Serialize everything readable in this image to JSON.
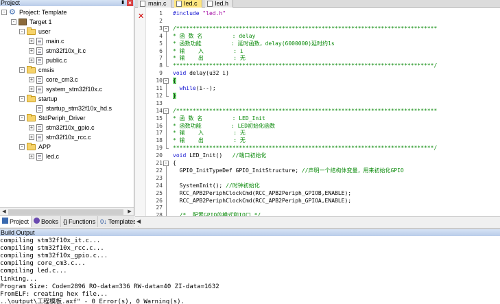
{
  "project_panel": {
    "title": "Project",
    "pin_icon": "pin-icon",
    "close_icon": "close-icon",
    "tree": [
      {
        "label": "Project: Template",
        "level": 0,
        "kind": "project",
        "expander": "-"
      },
      {
        "label": "Target 1",
        "level": 1,
        "kind": "target",
        "expander": "-"
      },
      {
        "label": "user",
        "level": 2,
        "kind": "folder",
        "expander": "-"
      },
      {
        "label": "main.c",
        "level": 3,
        "kind": "file",
        "expander": "+"
      },
      {
        "label": "stm32f10x_it.c",
        "level": 3,
        "kind": "file",
        "expander": "+"
      },
      {
        "label": "public.c",
        "level": 3,
        "kind": "file",
        "expander": "+"
      },
      {
        "label": "cmsis",
        "level": 2,
        "kind": "folder",
        "expander": "-"
      },
      {
        "label": "core_cm3.c",
        "level": 3,
        "kind": "file",
        "expander": "+"
      },
      {
        "label": "system_stm32f10x.c",
        "level": 3,
        "kind": "file",
        "expander": "+"
      },
      {
        "label": "startup",
        "level": 2,
        "kind": "folder",
        "expander": "-"
      },
      {
        "label": "startup_stm32f10x_hd.s",
        "level": 3,
        "kind": "file",
        "expander": ""
      },
      {
        "label": "StdPeriph_Driver",
        "level": 2,
        "kind": "folder",
        "expander": "-"
      },
      {
        "label": "stm32f10x_gpio.c",
        "level": 3,
        "kind": "file",
        "expander": "+"
      },
      {
        "label": "stm32f10x_rcc.c",
        "level": 3,
        "kind": "file",
        "expander": "+"
      },
      {
        "label": "APP",
        "level": 2,
        "kind": "folder",
        "expander": "-"
      },
      {
        "label": "led.c",
        "level": 3,
        "kind": "file",
        "expander": "+"
      }
    ],
    "tabs": [
      {
        "label": "Project",
        "icon": "project-icon",
        "active": true
      },
      {
        "label": "Books",
        "icon": "books-icon",
        "active": false
      },
      {
        "label": "Functions",
        "icon": "functions-icon",
        "active": false
      },
      {
        "label": "Templates",
        "icon": "templates-icon",
        "active": false
      }
    ]
  },
  "editor": {
    "tabs": [
      {
        "label": "main.c",
        "active": false
      },
      {
        "label": "led.c",
        "active": true
      },
      {
        "label": "led.h",
        "active": false
      }
    ],
    "error_marker": "✕",
    "lines": [
      {
        "n": "1",
        "text": "#include \"led.h\"",
        "cls": "pp",
        "fold": ""
      },
      {
        "n": "2",
        "text": "",
        "cls": "",
        "fold": ""
      },
      {
        "n": "3",
        "text": "/*******************************************************************************",
        "cls": "cm",
        "fold": "-"
      },
      {
        "n": "4",
        "text": "* 函 数 名         : delay",
        "cls": "cm",
        "fold": ""
      },
      {
        "n": "5",
        "text": "* 函数功能         : 延时函数，delay(6000000)延时约1s",
        "cls": "cm",
        "fold": ""
      },
      {
        "n": "6",
        "text": "* 输    入         : i",
        "cls": "cm",
        "fold": ""
      },
      {
        "n": "7",
        "text": "* 输    出         : 无",
        "cls": "cm",
        "fold": ""
      },
      {
        "n": "8",
        "text": "*******************************************************************************/",
        "cls": "cm",
        "fold": "end"
      },
      {
        "n": "9",
        "text": "void delay(u32 i)",
        "cls": "fn",
        "fold": ""
      },
      {
        "n": "10",
        "text": "{",
        "cls": "brace",
        "fold": "-"
      },
      {
        "n": "11",
        "text": "  while(i--);",
        "cls": "while",
        "fold": ""
      },
      {
        "n": "12",
        "text": "}",
        "cls": "brace",
        "fold": "end"
      },
      {
        "n": "13",
        "text": "",
        "cls": "",
        "fold": ""
      },
      {
        "n": "14",
        "text": "/*******************************************************************************",
        "cls": "cm",
        "fold": "-"
      },
      {
        "n": "15",
        "text": "* 函 数 名         : LED_Init",
        "cls": "cm",
        "fold": ""
      },
      {
        "n": "16",
        "text": "* 函数功能         : LED初始化函数",
        "cls": "cm",
        "fold": ""
      },
      {
        "n": "17",
        "text": "* 输    入         : 无",
        "cls": "cm",
        "fold": ""
      },
      {
        "n": "18",
        "text": "* 输    出         : 无",
        "cls": "cm",
        "fold": ""
      },
      {
        "n": "19",
        "text": "*******************************************************************************/",
        "cls": "cm",
        "fold": "end"
      },
      {
        "n": "20",
        "text": "void LED_Init()   //端口初始化",
        "cls": "fn2",
        "fold": ""
      },
      {
        "n": "21",
        "text": "{",
        "cls": "",
        "fold": "-"
      },
      {
        "n": "22",
        "text": "  GPIO_InitTypeDef GPIO_InitStructure; //声明一个结构体变量，用来初始化GPIO",
        "cls": "decl",
        "fold": ""
      },
      {
        "n": "23",
        "text": "",
        "cls": "",
        "fold": ""
      },
      {
        "n": "24",
        "text": "  SystemInit(); //时钟初始化",
        "cls": "sysinit",
        "fold": ""
      },
      {
        "n": "25",
        "text": "  RCC_APB2PeriphClockCmd(RCC_APB2Periph_GPIOB,ENABLE);",
        "cls": "",
        "fold": ""
      },
      {
        "n": "26",
        "text": "  RCC_APB2PeriphClockCmd(RCC_APB2Periph_GPIOA,ENABLE);",
        "cls": "",
        "fold": ""
      },
      {
        "n": "27",
        "text": "",
        "cls": "",
        "fold": ""
      },
      {
        "n": "28",
        "text": "  /*  配置GPIO的模式和IO口 */",
        "cls": "cm",
        "fold": ""
      }
    ]
  },
  "build": {
    "title": "Build Output",
    "lines": [
      "compiling stm32f10x_it.c...",
      "compiling stm32f10x_rcc.c...",
      "compiling stm32f10x_gpio.c...",
      "compiling core_cm3.c...",
      "compiling led.c...",
      "linking...",
      "Program Size: Code=2896 RO-data=336 RW-data=40 ZI-data=1632",
      "FromELF: creating hex file...",
      "..\\output\\工程模板.axf\" - 0 Error(s), 0 Warning(s)."
    ]
  },
  "colors": {
    "comment": "#0a8a0a",
    "keyword": "#1010d0",
    "active_tab": "#ffe680",
    "error": "#d00000",
    "brace_highlight": "#6fe06f"
  }
}
